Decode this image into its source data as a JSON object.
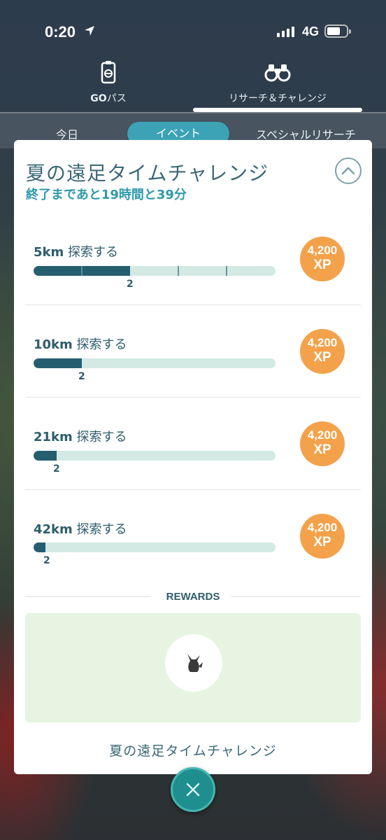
{
  "status_bar": {
    "time": "0:20",
    "network": "4G"
  },
  "top_tabs": {
    "go_pass_bold": "GO",
    "go_pass_rest": "パス",
    "research": "リサーチ＆チャレンジ",
    "active": "research"
  },
  "sub_tabs": {
    "today": "今日",
    "event": "イベント",
    "special": "スペシャルリサーチ",
    "active": "event"
  },
  "challenge": {
    "title": "夏の遠足タイムチャレンジ",
    "time_remaining": "終了まであと19時間と39分",
    "tasks": [
      {
        "distance": "5km",
        "action": "探索する",
        "progress": 2,
        "goal_km": 5,
        "fill_fraction": 0.4,
        "reward_amount": "4,200",
        "reward_unit": "XP"
      },
      {
        "distance": "10km",
        "action": "探索する",
        "progress": 2,
        "goal_km": 10,
        "fill_fraction": 0.2,
        "reward_amount": "4,200",
        "reward_unit": "XP"
      },
      {
        "distance": "21km",
        "action": "探索する",
        "progress": 2,
        "goal_km": 21,
        "fill_fraction": 0.095,
        "reward_amount": "4,200",
        "reward_unit": "XP"
      },
      {
        "distance": "42km",
        "action": "探索する",
        "progress": 2,
        "goal_km": 42,
        "fill_fraction": 0.048,
        "reward_amount": "4,200",
        "reward_unit": "XP"
      }
    ],
    "rewards_heading": "REWARDS",
    "reward_name": "夏の遠足タイムチャレンジ"
  },
  "colors": {
    "accent": "#3ba3b5",
    "xp_badge": "#f3a24b",
    "progress_fill": "#255f6f",
    "progress_track": "#d3e9e4",
    "rewards_bg": "#e6f4e1"
  }
}
